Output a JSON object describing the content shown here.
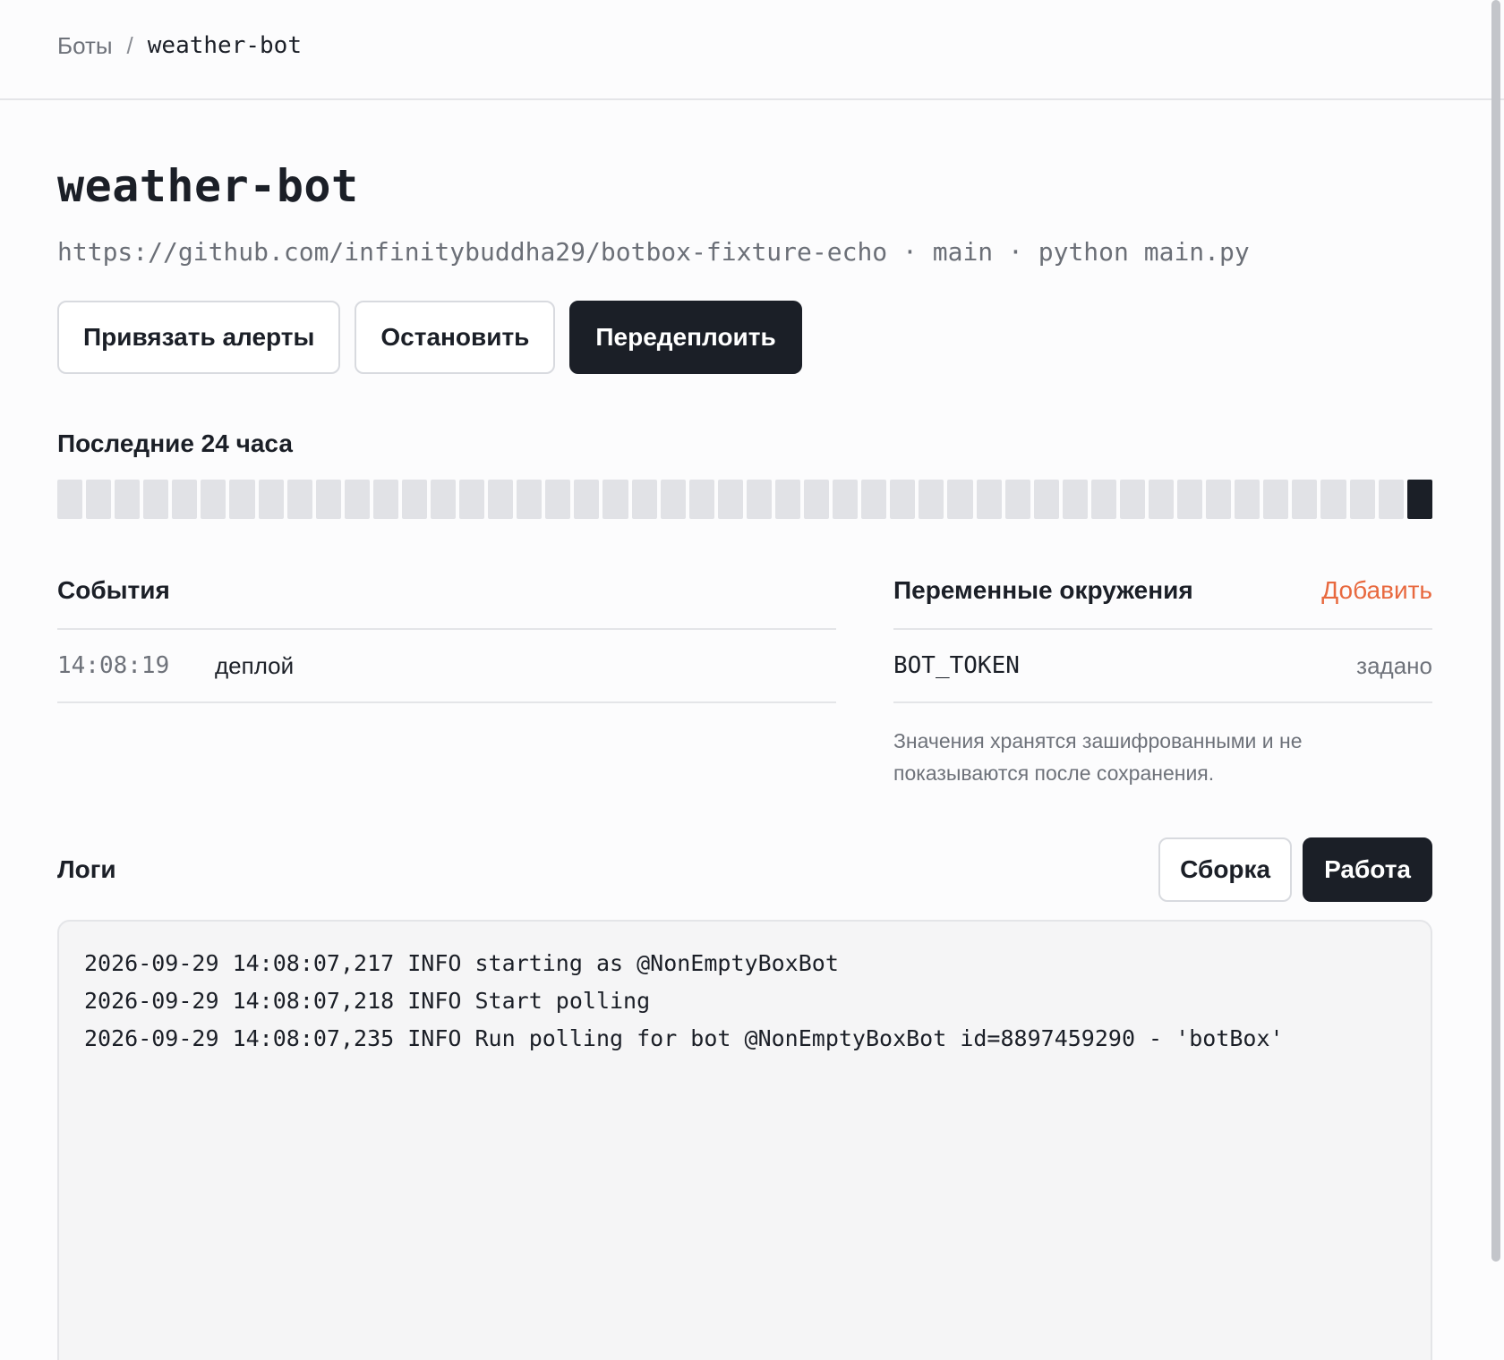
{
  "breadcrumb": {
    "root": "Боты",
    "separator": "/",
    "current": "weather-bot"
  },
  "bot": {
    "name": "weather-bot",
    "meta": "https://github.com/infinitybuddha29/botbox-fixture-echo · main · python main.py"
  },
  "actions": {
    "bind_alerts": "Привязать алерты",
    "stop": "Остановить",
    "redeploy": "Передеплоить"
  },
  "uptime": {
    "title": "Последние 24 часа",
    "cells_total": 48,
    "active_cells": [
      47
    ]
  },
  "events": {
    "title": "События",
    "items": [
      {
        "time": "14:08:19",
        "text": "деплой"
      }
    ]
  },
  "env": {
    "title": "Переменные окружения",
    "add_label": "Добавить",
    "items": [
      {
        "key": "BOT_TOKEN",
        "status": "задано"
      }
    ],
    "note": "Значения хранятся зашифрованными и не показываются после сохранения."
  },
  "logs": {
    "title": "Логи",
    "tabs": [
      {
        "label": "Сборка",
        "active": false
      },
      {
        "label": "Работа",
        "active": true
      }
    ],
    "lines": [
      "2026-09-29 14:08:07,217 INFO starting as @NonEmptyBoxBot",
      "2026-09-29 14:08:07,218 INFO Start polling",
      "2026-09-29 14:08:07,235 INFO Run polling for bot @NonEmptyBoxBot id=8897459290 - 'botBox'"
    ]
  },
  "colors": {
    "accent": "#e8693f",
    "dark": "#1b1f27",
    "muted": "#6e727a"
  }
}
